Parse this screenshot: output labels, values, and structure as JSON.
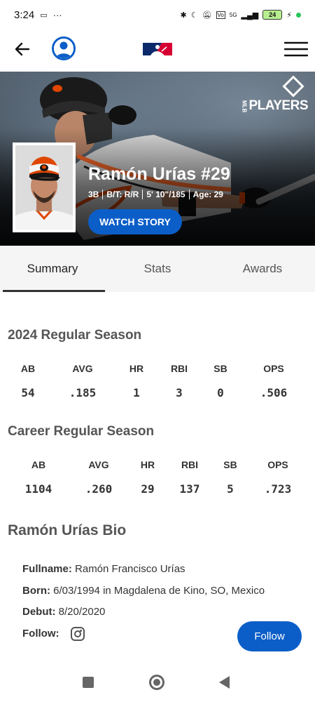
{
  "status_bar": {
    "time": "3:24",
    "battery": "24",
    "network": "5G"
  },
  "app_bar": {
    "logo_name": "mlb-logo"
  },
  "hero": {
    "players_brand": "PLAYERS",
    "players_brand_prefix": "MLB",
    "name": "Ramón Urías #29",
    "position": "3B",
    "bats_throws": "B/T: R/R",
    "height_weight": "5' 10\"/185",
    "age": "Age: 29",
    "watch_label": "WATCH STORY"
  },
  "tabs": [
    {
      "label": "Summary",
      "active": true
    },
    {
      "label": "Stats",
      "active": false
    },
    {
      "label": "Awards",
      "active": false
    }
  ],
  "season": {
    "title": "2024 Regular Season",
    "headers": [
      "AB",
      "AVG",
      "HR",
      "RBI",
      "SB",
      "OPS"
    ],
    "values": [
      "54",
      ".185",
      "1",
      "3",
      "0",
      ".506"
    ]
  },
  "career": {
    "title": "Career Regular Season",
    "headers": [
      "AB",
      "AVG",
      "HR",
      "RBI",
      "SB",
      "OPS"
    ],
    "values": [
      "1104",
      ".260",
      "29",
      "137",
      "5",
      ".723"
    ]
  },
  "bio": {
    "title": "Ramón Urías Bio",
    "fullname_label": "Fullname:",
    "fullname": "Ramón Francisco Urías",
    "born_label": "Born:",
    "born": "6/03/1994 in Magdalena de Kino, SO, Mexico",
    "debut_label": "Debut:",
    "debut": "8/20/2020",
    "follow_label": "Follow:",
    "follow_button": "Follow"
  },
  "colors": {
    "accent": "#0b5ec8",
    "orioles_orange": "#df4601"
  }
}
